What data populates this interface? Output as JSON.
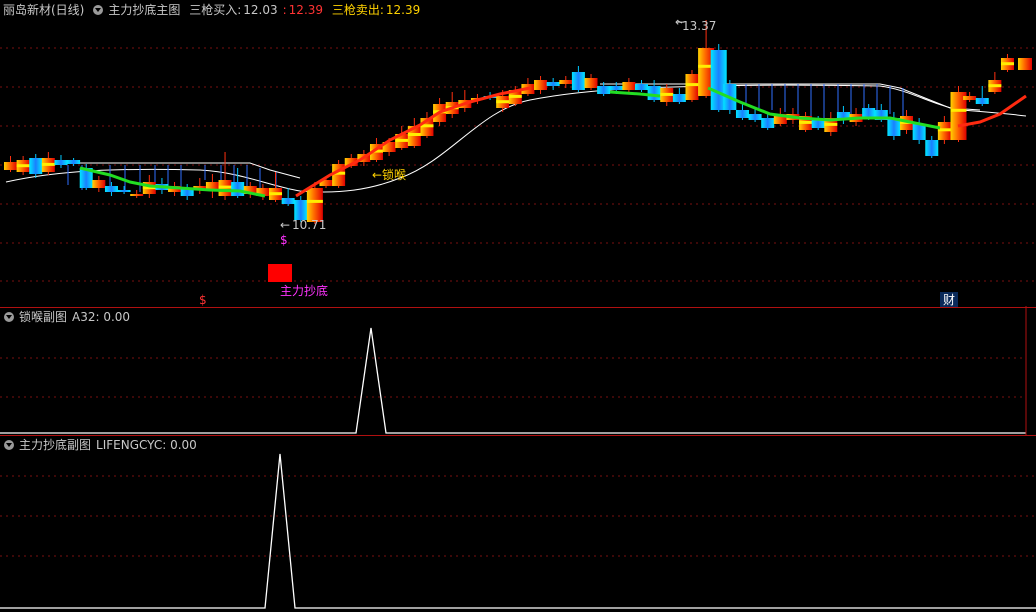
{
  "main": {
    "stock": "丽岛新材(日线)",
    "indicator": "主力抄底主图",
    "buy_label": "三枪买入:",
    "buy_value": "12.03",
    "sep_value": "12.39",
    "sell_label": "三枪卖出:",
    "sell_value": "12.39",
    "high_label": "13.37",
    "low_label": "10.71",
    "lock_label": "←锁喉",
    "dollar_mark": "$",
    "signal_label": "主力抄底",
    "axis_mark_left": "$",
    "axis_mark_right": "财"
  },
  "sub1": {
    "title": "锁喉副图",
    "field": "A32: 0.00"
  },
  "sub2": {
    "title": "主力抄底副图",
    "field": "LIFENGCYC: 0.00"
  },
  "colors": {
    "up": "#ff2a10",
    "down": "#00c8ff",
    "yellow": "#ffd200",
    "green": "#22dd22",
    "magenta": "#ff33ff",
    "separator": "#b01010",
    "grid": "#8a1010"
  }
}
